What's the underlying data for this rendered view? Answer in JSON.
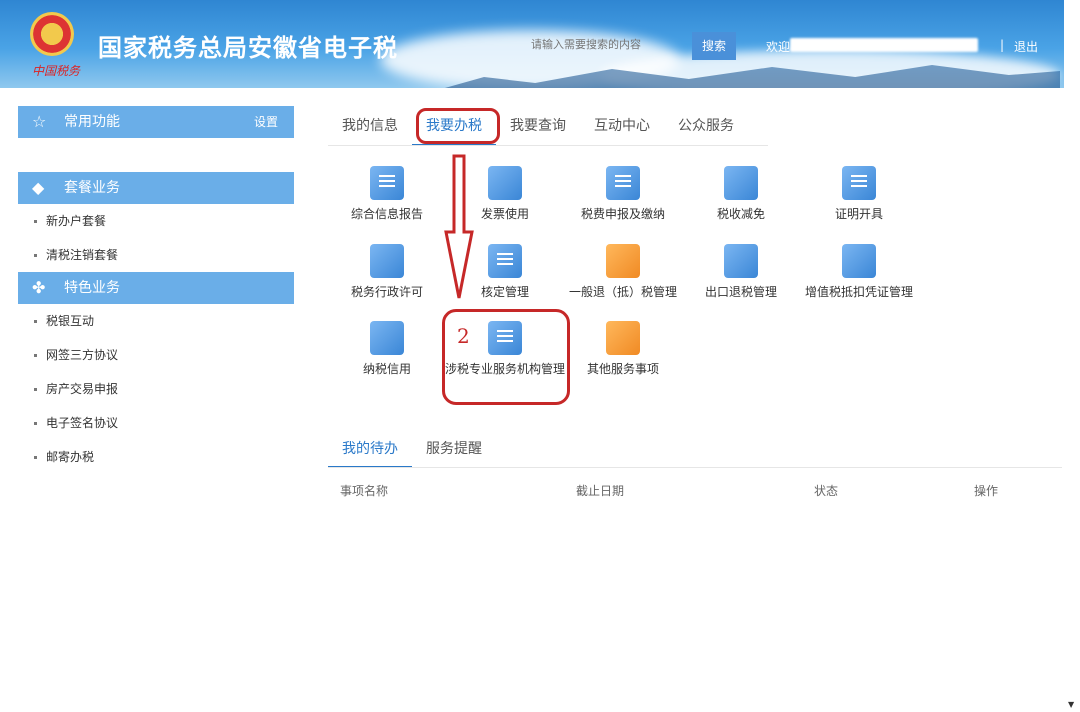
{
  "header": {
    "title": "国家税务总局安徽省电子税",
    "emblem_caption": "中国税务",
    "search_placeholder": "请输入需要搜索的内容",
    "search_button": "搜索",
    "welcome": "欢迎",
    "separator": "|",
    "logout": "退出"
  },
  "sidebar": {
    "common": {
      "title": "常用功能",
      "settings": "设置"
    },
    "package": {
      "title": "套餐业务",
      "items": [
        "新办户套餐",
        "清税注销套餐"
      ]
    },
    "special": {
      "title": "特色业务",
      "items": [
        "税银互动",
        "网签三方协议",
        "房产交易申报",
        "电子签名协议",
        "邮寄办税"
      ]
    }
  },
  "tabs": [
    "我的信息",
    "我要办税",
    "我要查询",
    "互动中心",
    "公众服务"
  ],
  "tiles": [
    {
      "label": "综合信息报告",
      "icon": "document-list-icon"
    },
    {
      "label": "发票使用",
      "icon": "invoice-icon"
    },
    {
      "label": "税费申报及缴纳",
      "icon": "tax-declaration-icon"
    },
    {
      "label": "税收减免",
      "icon": "yen-coupon-icon"
    },
    {
      "label": "证明开具",
      "icon": "certificate-icon"
    },
    {
      "label": "税务行政许可",
      "icon": "chart-icon"
    },
    {
      "label": "核定管理",
      "icon": "stamp-icon"
    },
    {
      "label": "一般退（抵）税管理",
      "icon": "refund-icon"
    },
    {
      "label": "出口退税管理",
      "icon": "export-refund-icon"
    },
    {
      "label": "增值税抵扣凭证管理",
      "icon": "voucher-icon"
    },
    {
      "label": "纳税信用",
      "icon": "credit-user-icon"
    },
    {
      "label": "涉税专业服务机构管理",
      "icon": "agency-icon"
    },
    {
      "label": "其他服务事项",
      "icon": "grid-icon"
    }
  ],
  "annotation": {
    "step": "2"
  },
  "bottom_tabs": [
    "我的待办",
    "服务提醒"
  ],
  "table_headers": [
    "事项名称",
    "截止日期",
    "状态",
    "操作"
  ]
}
